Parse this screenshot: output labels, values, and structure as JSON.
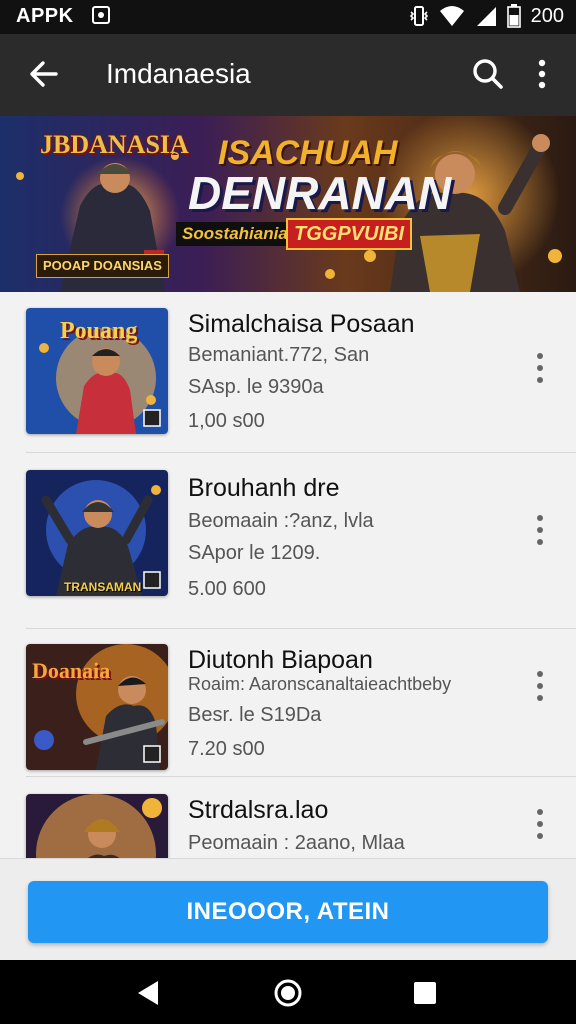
{
  "status_bar": {
    "carrier": "APPK",
    "time": "200"
  },
  "app_bar": {
    "title": "Imdanaesia"
  },
  "banner": {
    "title_logo": "JBDANASIA",
    "headline_top": "ISACHUAH",
    "headline_main": "DENRANAN",
    "subtitle": "Soostahianiae",
    "badge": "TGGPVUIBI",
    "small_tag": "POOAP DOANSIAS"
  },
  "list": {
    "items": [
      {
        "name": "Simalchaisa Posaan",
        "meta": "Bemaniant.772, San",
        "submeta": "SAsp. le 9390a",
        "price": "1,00 s00",
        "thumb_title": "Pouang"
      },
      {
        "name": "Brouhanh dre",
        "meta": "Beomaain :?anz, lvla",
        "submeta": "SApor le 1209.",
        "price": "5.00 600",
        "thumb_title": "TRANSAMAN"
      },
      {
        "name": "Diutonh Biapoan",
        "meta": "Roaim: Aaronscanaltaieachtbeby",
        "submeta": "Besr. le S19Da",
        "price": "7.20 s00",
        "thumb_title": "Doanaia"
      },
      {
        "name": "Strdalsra.lao",
        "meta": "Peomaain : 2aano, Mlaa"
      }
    ]
  },
  "cta": {
    "label": "INEOOOR, ATEIN"
  },
  "colors": {
    "accent": "#2196f3",
    "app_bar": "#2b2b2b",
    "status_bar": "#111111"
  },
  "icons": {
    "back": "arrow-back-icon",
    "search": "search-icon",
    "more": "more-vert-icon",
    "nav_back": "triangle-back-icon",
    "nav_home": "circle-home-icon",
    "nav_recent": "square-recent-icon"
  }
}
